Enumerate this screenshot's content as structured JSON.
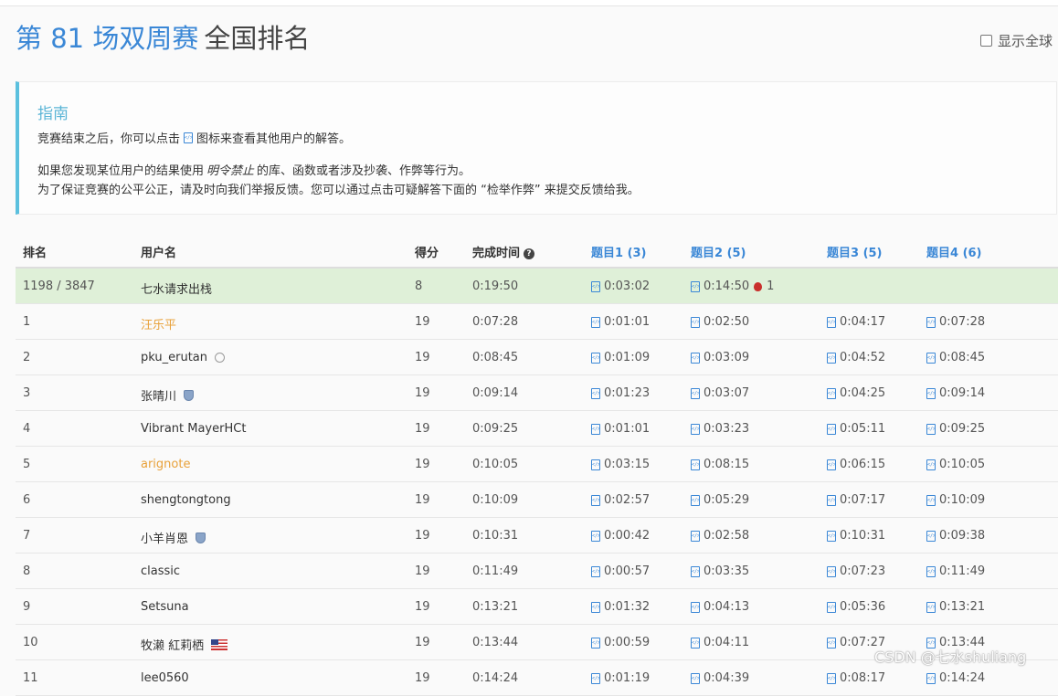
{
  "header": {
    "title_accent": "第 81 场双周赛",
    "title_rest": "全国排名",
    "show_global_label": "显示全球"
  },
  "guide": {
    "title": "指南",
    "line1_before": "竞赛结束之后，你可以点击",
    "line1_after": "图标来查看其他用户的解答。",
    "line2_before": "如果您发现某位用户的结果使用",
    "line2_em": "明令禁止",
    "line2_after": "的库、函数或者涉及抄袭、作弊等行为。",
    "line3": "为了保证竞赛的公平公正，请及时向我们举报反馈。您可以通过点击可疑解答下面的 “检举作弊” 来提交反馈给我。"
  },
  "table": {
    "headers": {
      "rank": "排名",
      "user": "用户名",
      "score": "得分",
      "time": "完成时间",
      "q1": "题目1 (3)",
      "q2": "题目2 (5)",
      "q3": "题目3 (5)",
      "q4": "题目4 (6)"
    },
    "my_row": {
      "rank": "1198 / 3847",
      "user": "七水请求出栈",
      "score": "8",
      "time": "0:19:50",
      "q1": "0:03:02",
      "q2": "0:14:50",
      "q2_penalty": "1"
    },
    "rows": [
      {
        "rank": "1",
        "user": "汪乐平",
        "score": "19",
        "time": "0:07:28",
        "q1": "0:01:01",
        "q2": "0:02:50",
        "q3": "0:04:17",
        "q4": "0:07:28"
      },
      {
        "rank": "2",
        "user": "pku_erutan",
        "score": "19",
        "time": "0:08:45",
        "q1": "0:01:09",
        "q2": "0:03:09",
        "q3": "0:04:52",
        "q4": "0:08:45"
      },
      {
        "rank": "3",
        "user": "张晴川",
        "score": "19",
        "time": "0:09:14",
        "q1": "0:01:23",
        "q2": "0:03:07",
        "q3": "0:04:25",
        "q4": "0:09:14"
      },
      {
        "rank": "4",
        "user": "Vibrant MayerHCt",
        "score": "19",
        "time": "0:09:25",
        "q1": "0:01:01",
        "q2": "0:03:23",
        "q3": "0:05:11",
        "q4": "0:09:25"
      },
      {
        "rank": "5",
        "user": "arignote",
        "score": "19",
        "time": "0:10:05",
        "q1": "0:03:15",
        "q2": "0:08:15",
        "q3": "0:06:15",
        "q4": "0:10:05"
      },
      {
        "rank": "6",
        "user": "shengtongtong",
        "score": "19",
        "time": "0:10:09",
        "q1": "0:02:57",
        "q2": "0:05:29",
        "q3": "0:07:17",
        "q4": "0:10:09"
      },
      {
        "rank": "7",
        "user": "小羊肖恩",
        "score": "19",
        "time": "0:10:31",
        "q1": "0:00:42",
        "q2": "0:02:58",
        "q3": "0:10:31",
        "q4": "0:09:38"
      },
      {
        "rank": "8",
        "user": "classic",
        "score": "19",
        "time": "0:11:49",
        "q1": "0:00:57",
        "q2": "0:03:35",
        "q3": "0:07:23",
        "q4": "0:11:49"
      },
      {
        "rank": "9",
        "user": "Setsuna",
        "score": "19",
        "time": "0:13:21",
        "q1": "0:01:32",
        "q2": "0:04:13",
        "q3": "0:05:36",
        "q4": "0:13:21"
      },
      {
        "rank": "10",
        "user": "牧濑 紅莉栖",
        "score": "19",
        "time": "0:13:44",
        "q1": "0:00:59",
        "q2": "0:04:11",
        "q3": "0:07:27",
        "q4": "0:13:44"
      },
      {
        "rank": "11",
        "user": "lee0560",
        "score": "19",
        "time": "0:14:24",
        "q1": "0:01:19",
        "q2": "0:04:39",
        "q3": "0:08:17",
        "q4": "0:14:24"
      }
    ]
  },
  "watermark": "CSDN @七水shuliang",
  "colors": {
    "accent": "#3a87d6",
    "highlight_row": "#dff0d8",
    "guide_border": "#5bc0de",
    "orange_user": "#e8a13a"
  }
}
